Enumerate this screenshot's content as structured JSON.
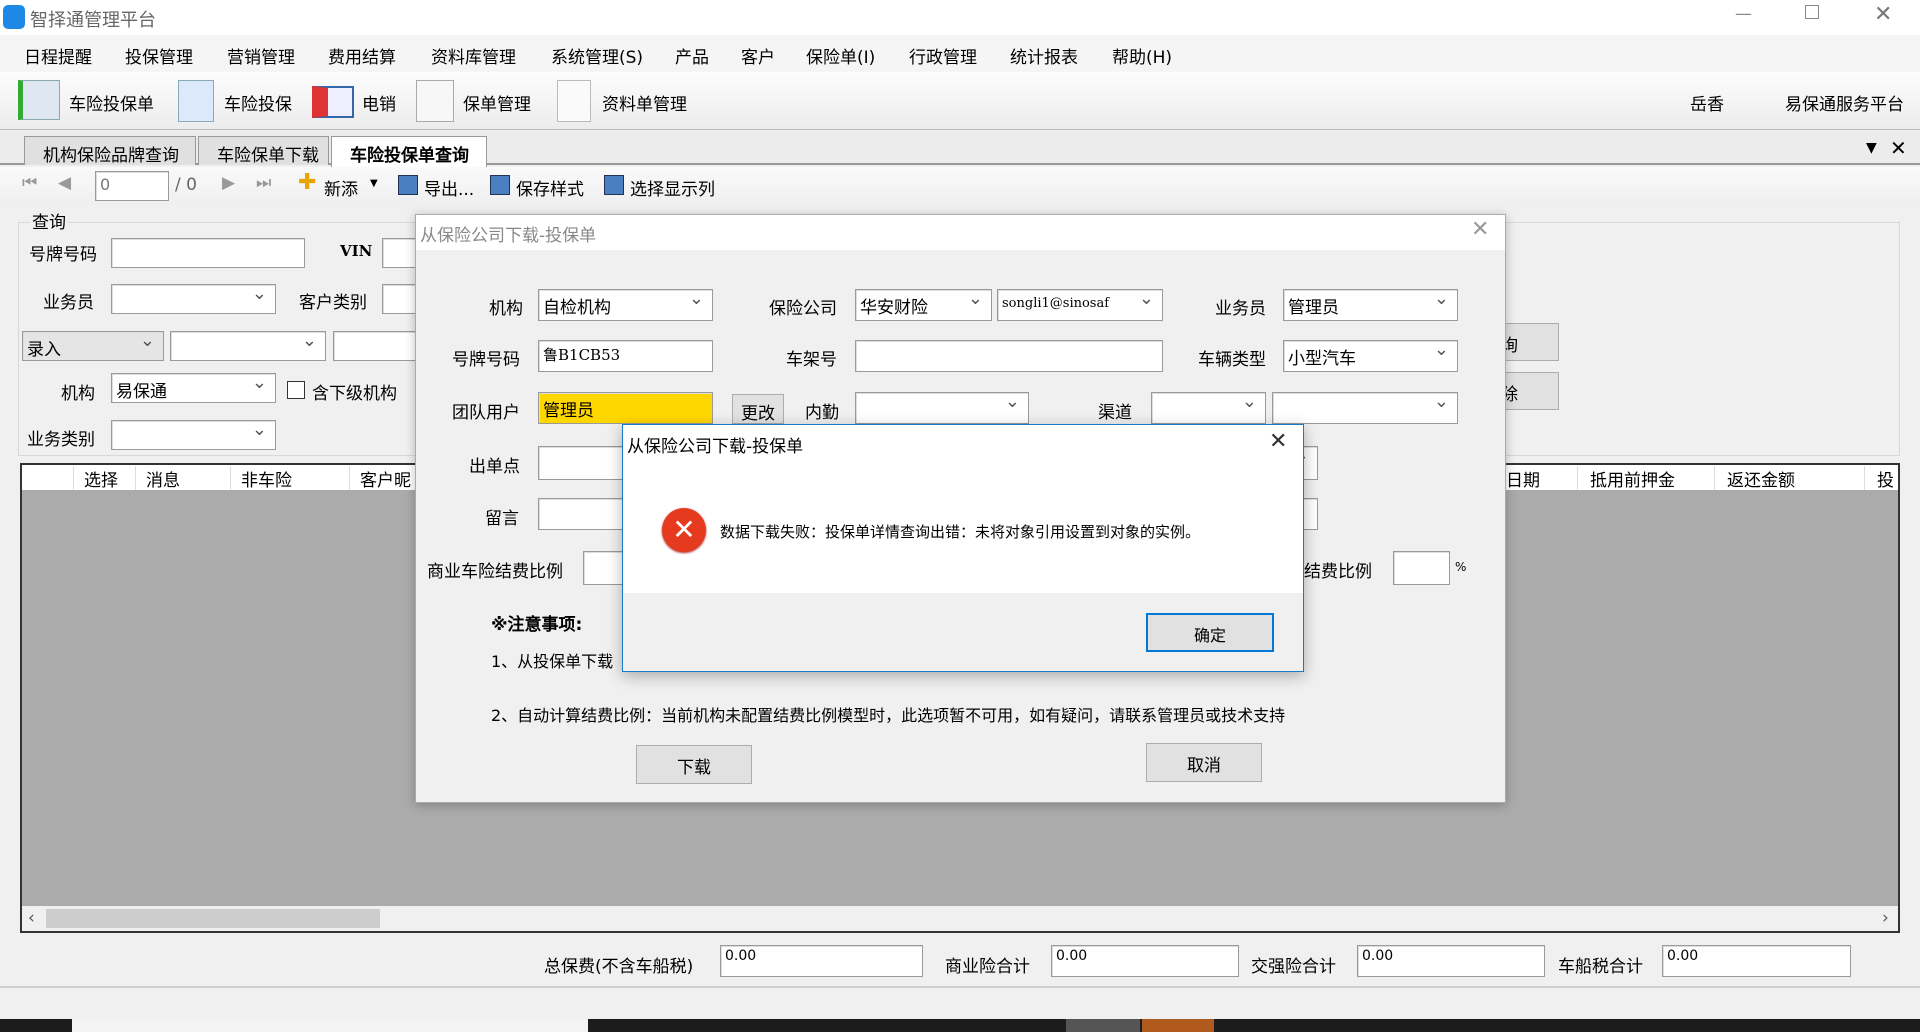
{
  "app": {
    "title": "智择通管理平台",
    "window_controls": [
      "minimize",
      "restore",
      "close"
    ]
  },
  "menu": [
    "日程提醒",
    "投保管理",
    "营销管理",
    "费用结算",
    "资料库管理",
    "系统管理(S)",
    "产品",
    "客户",
    "保险单(I)",
    "行政管理",
    "统计报表",
    "帮助(H)"
  ],
  "toolbar": {
    "items": [
      "车险投保单",
      "车险投保",
      "电销",
      "保单管理",
      "资料单管理"
    ],
    "user": "岳香",
    "platform": "易保通服务平台"
  },
  "tabs": [
    "机构保险品牌查询",
    "车险保单下载",
    "车险投保单查询"
  ],
  "nav": {
    "page": "0",
    "total": "/ 0",
    "new": "新添",
    "export": "导出...",
    "save_style": "保存样式",
    "select_columns": "选择显示列"
  },
  "query": {
    "group": "查询",
    "plate_label": "号牌号码",
    "vin_label": "VIN",
    "salesman_label": "业务员",
    "customer_type_label": "客户类别",
    "entry_select": "录入",
    "org_label": "机构",
    "org_value": "易保通",
    "include_sub": "含下级机构",
    "biz_type_label": "业务类别",
    "search_btn_partial": "询",
    "delete_btn_partial": "除"
  },
  "grid": {
    "left_columns": [
      "",
      "选择",
      "消息",
      "非车险",
      "客户昵"
    ],
    "right_columns": [
      "日期",
      "抵用前押金",
      "返还金额",
      "投"
    ]
  },
  "totals": {
    "total_label": "总保费(不含车船税)",
    "total": "0.00",
    "commercial_label": "商业险合计",
    "commercial": "0.00",
    "compulsory_label": "交强险合计",
    "compulsory": "0.00",
    "vessel_label": "车船税合计",
    "vessel": "0.00"
  },
  "dialog": {
    "title": "从保险公司下载-投保单",
    "org_label": "机构",
    "org": "自检机构",
    "insurer_label": "保险公司",
    "insurer": "华安财险",
    "account": "songli1@sinosaf",
    "salesman_label": "业务员",
    "salesman": "管理员",
    "plate_label": "号牌号码",
    "plate": "鲁B1CB53",
    "frame_label": "车架号",
    "frame": "",
    "vehicle_type_label": "车辆类型",
    "vehicle_type": "小型汽车",
    "team_user_label": "团队用户",
    "team_user": "管理员",
    "change_btn": "更改",
    "internal_label": "内勤",
    "channel_label": "渠道",
    "issue_point_label": "出单点",
    "message_label": "留言",
    "commercial_ratio_label": "商业车险结费比例",
    "ratio_label_partial": "结费比例",
    "percent": "%",
    "notes_title": "※注意事项:",
    "note1": "1、从投保单下载",
    "note2": "2、自动计算结费比例：当前机构未配置结费比例模型时，此选项暂不可用，如有疑问，请联系管理员或技术支持",
    "download_btn": "下载",
    "cancel_btn": "取消"
  },
  "msgbox": {
    "title": "从保险公司下载-投保单",
    "text": "数据下载失败：投保单详情查询出错：未将对象引用设置到对象的实例。",
    "ok": "确定",
    "error_color": "#e53a1e"
  }
}
